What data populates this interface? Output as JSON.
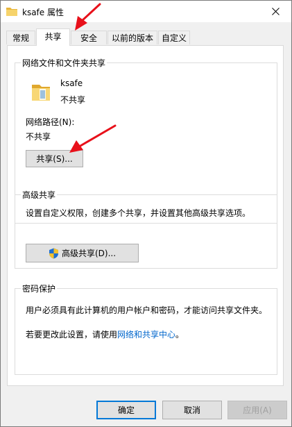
{
  "window": {
    "title": "ksafe 属性",
    "icon": "folder-icon"
  },
  "tabs": [
    {
      "label": "常规",
      "active": false
    },
    {
      "label": "共享",
      "active": true
    },
    {
      "label": "安全",
      "active": false
    },
    {
      "label": "以前的版本",
      "active": false
    },
    {
      "label": "自定义",
      "active": false
    }
  ],
  "network_share": {
    "group_title": "网络文件和文件夹共享",
    "folder_name": "ksafe",
    "folder_status": "不共享",
    "path_label": "网络路径(N):",
    "path_value": "不共享",
    "share_button": "共享(S)..."
  },
  "advanced_share": {
    "group_title": "高级共享",
    "description": "设置自定义权限，创建多个共享，并设置其他高级共享选项。",
    "button": "高级共享(D)..."
  },
  "password_protection": {
    "group_title": "密码保护",
    "line1": "用户必须具有此计算机的用户帐户和密码，才能访问共享文件夹。",
    "line2_prefix": "若要更改此设置，请使用",
    "line2_link": "网络和共享中心",
    "line2_suffix": "。"
  },
  "footer": {
    "ok": "确定",
    "cancel": "取消",
    "apply": "应用(A)"
  },
  "colors": {
    "accent": "#0078d7",
    "link": "#0066cc",
    "annotation_arrow": "#e8101a",
    "folder": "#f2c94c"
  }
}
